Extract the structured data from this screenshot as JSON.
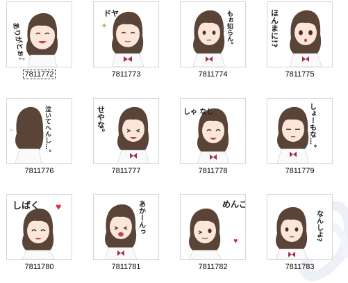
{
  "items": [
    {
      "id": "7811772",
      "text": "ありがとぉ♪",
      "selected": true
    },
    {
      "id": "7811773",
      "text": "ドヤ",
      "selected": false
    },
    {
      "id": "7811774",
      "text": "もぉ知らん。",
      "selected": false
    },
    {
      "id": "7811775",
      "text": "ほんまに!?",
      "selected": false
    },
    {
      "id": "7811776",
      "text": "泣いてへんし…。",
      "selected": false
    },
    {
      "id": "7811777",
      "text": "せやな。",
      "selected": false
    },
    {
      "id": "7811778",
      "text": "しゃ なし",
      "selected": false
    },
    {
      "id": "7811779",
      "text": "しょーもな…。",
      "selected": false
    },
    {
      "id": "7811780",
      "text": "しばく",
      "selected": false
    },
    {
      "id": "7811781",
      "text": "あかーんっ",
      "selected": false
    },
    {
      "id": "7811782",
      "text": "めんご",
      "selected": false
    },
    {
      "id": "7811783",
      "text": "なんしよ?",
      "selected": false
    }
  ]
}
